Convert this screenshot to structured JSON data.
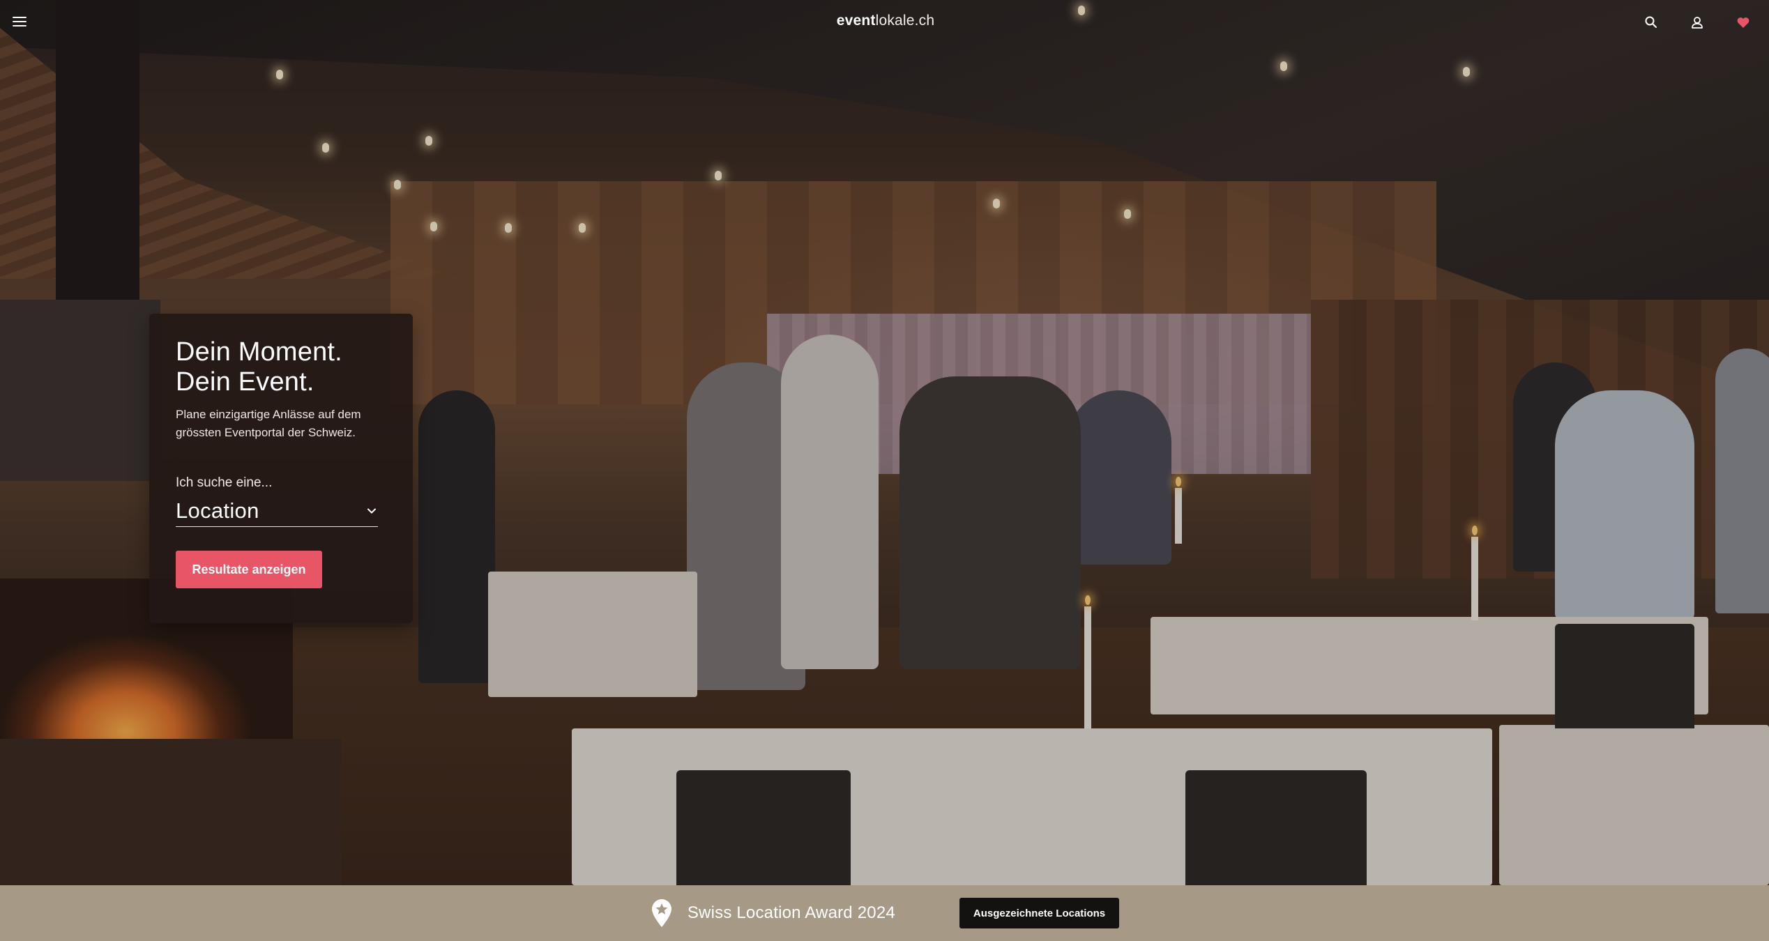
{
  "header": {
    "logo_bold": "event",
    "logo_light": "lokale.ch",
    "icons": [
      "menu-icon",
      "search-icon",
      "user-icon",
      "heart-icon"
    ],
    "heart_color": "#e85566"
  },
  "hero": {
    "headline_line1": "Dein Moment.",
    "headline_line2": "Dein Event.",
    "subtitle": "Plane einzigartige Anlässe auf dem grössten Eventportal der Schweiz.",
    "search_label": "Ich suche eine...",
    "select_value": "Location",
    "button_label": "Resultate anzeigen",
    "button_color": "#e85566"
  },
  "award_banner": {
    "text": "Swiss Location Award 2024",
    "button_label": "Ausgezeichnete Locations",
    "background": "#a69a86"
  }
}
